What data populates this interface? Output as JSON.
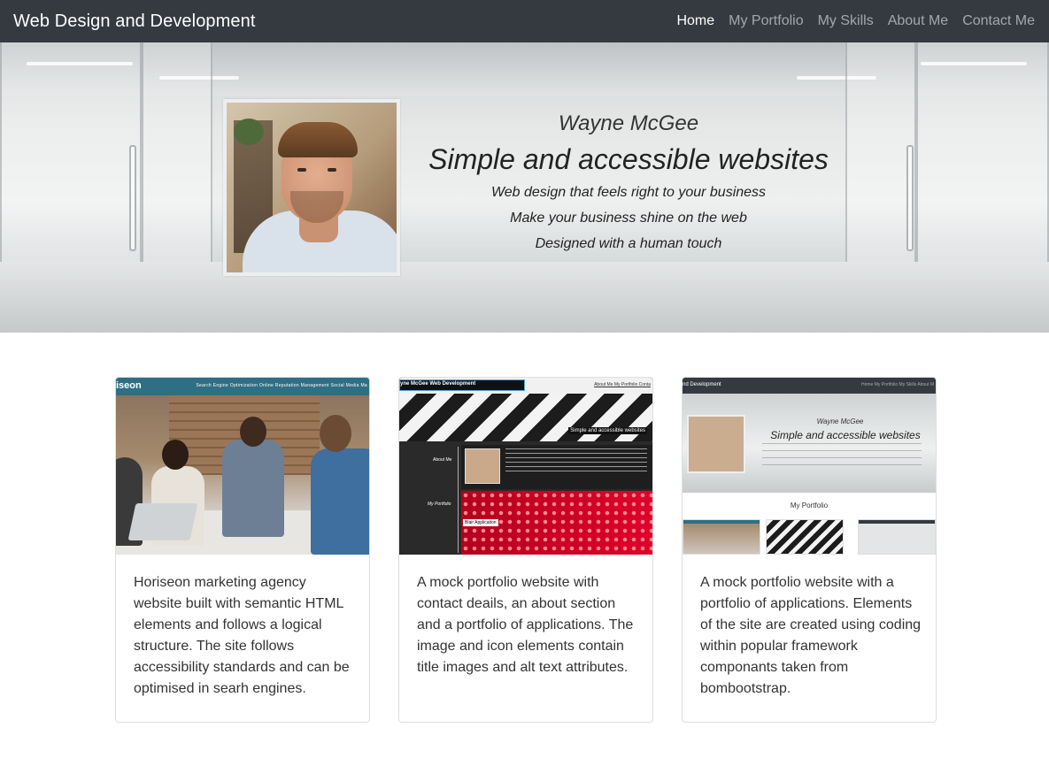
{
  "navbar": {
    "brand": "Web Design and Development",
    "links": [
      {
        "label": "Home",
        "active": true
      },
      {
        "label": "My Portfolio",
        "active": false
      },
      {
        "label": "My Skills",
        "active": false
      },
      {
        "label": "About Me",
        "active": false
      },
      {
        "label": "Contact Me",
        "active": false
      }
    ]
  },
  "hero": {
    "name": "Wayne McGee",
    "tagline": "Simple and accessible websites",
    "lines": [
      "Web design that feels right to your business",
      "Make your business shine on the web",
      "Designed with a human touch"
    ]
  },
  "cards": [
    {
      "thumb": {
        "logo": "iseon",
        "links": "Search Engine Optimization    Online Reputation Management    Social Media Ma"
      },
      "text": "Horiseon marketing agency website built with semantic HTML elements and follows a logical structure. The site follows accessibility standards and can be optimised in searh engines."
    },
    {
      "thumb": {
        "title": "yne McGee Web Development",
        "links": "About Me   My Portfolio   Conta",
        "banner": "Simple and accessible websites",
        "about_label": "About Me",
        "portfolio_label": "My Portfolio",
        "app_label": "Blair Application"
      },
      "text": "A mock portfolio website with contact deails, an about section and a portfolio of applications. The image and icon elements contain title images and alt text attributes."
    },
    {
      "thumb": {
        "title": "nd Development",
        "links": "Home   My Portfolio   My Skills   About M",
        "name": "Wayne McGee",
        "tagline": "Simple and accessible websites",
        "portfolio_title": "My Portfolio"
      },
      "text": "A mock portfolio website with a portfolio of applications. Elements of the site are created using coding within popular framework componants taken from bombootstrap."
    }
  ],
  "colors": {
    "navbar": "#343a40",
    "nav_active": "#ffffff",
    "nav_inactive": "rgba(255,255,255,0.55)"
  }
}
